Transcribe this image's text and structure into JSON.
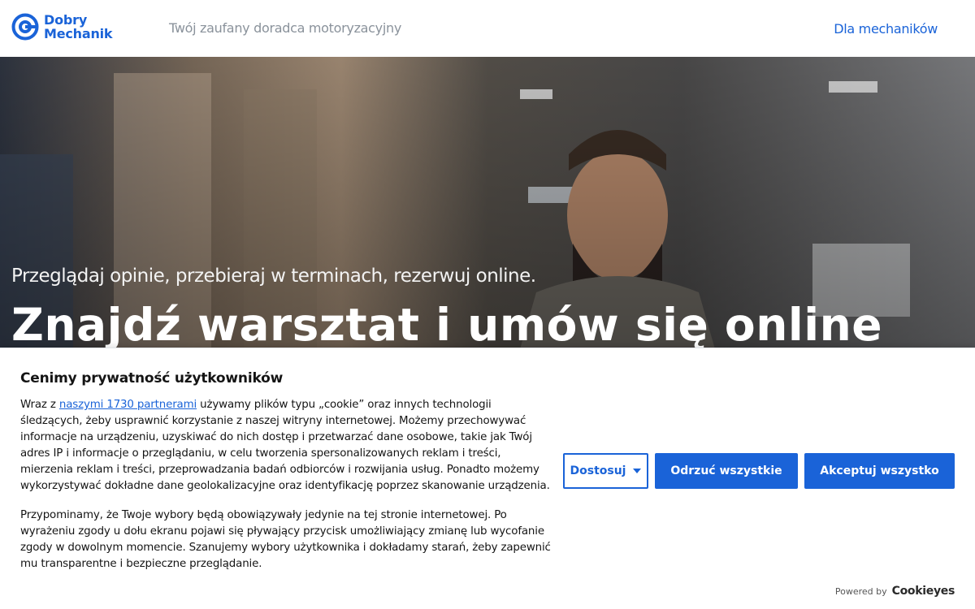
{
  "header": {
    "logo_line1": "Dobry",
    "logo_line2": "Mechanik",
    "tagline": "Twój zaufany doradca motoryzacyjny",
    "nav_link": "Dla mechaników"
  },
  "hero": {
    "subtitle": "Przeglądaj opinie, przebieraj w terminach, rezerwuj online.",
    "title": "Znajdź warsztat i umów się online"
  },
  "cookie": {
    "title": "Cenimy prywatność użytkowników",
    "p1_before": "Wraz z ",
    "p1_link": "naszymi 1730 partnerami",
    "p1_after": " używamy plików typu „cookie” oraz innych technologii śledzących, żeby usprawnić korzystanie z naszej witryny internetowej. Możemy przechowywać informacje na urządzeniu, uzyskiwać do nich dostęp i przetwarzać dane osobowe, takie jak Twój adres IP i informacje o przeglądaniu, w celu tworzenia spersonalizowanych reklam i treści, mierzenia reklam i treści, przeprowadzania badań odbiorców i rozwijania usług. Ponadto możemy wykorzystywać dokładne dane geolokalizacyjne oraz identyfikację poprzez skanowanie urządzenia.",
    "p2": "Przypominamy, że Twoje wybory będą obowiązywały jedynie na tej stronie internetowej. Po wyrażeniu zgody u dołu ekranu pojawi się pływający przycisk umożliwiający zmianę lub wycofanie zgody w dowolnym momencie. Szanujemy wybory użytkownika i dokładamy starań, żeby zapewnić mu transparentne i bezpieczne przeglądanie.",
    "btn_customize": "Dostosuj",
    "btn_reject": "Odrzuć wszystkie",
    "btn_accept": "Akceptuj wszystko",
    "powered_label": "Powered by",
    "powered_brand": "Cookieyes"
  },
  "colors": {
    "brand_blue": "#1a63d8",
    "tagline_gray": "#8a929b"
  }
}
